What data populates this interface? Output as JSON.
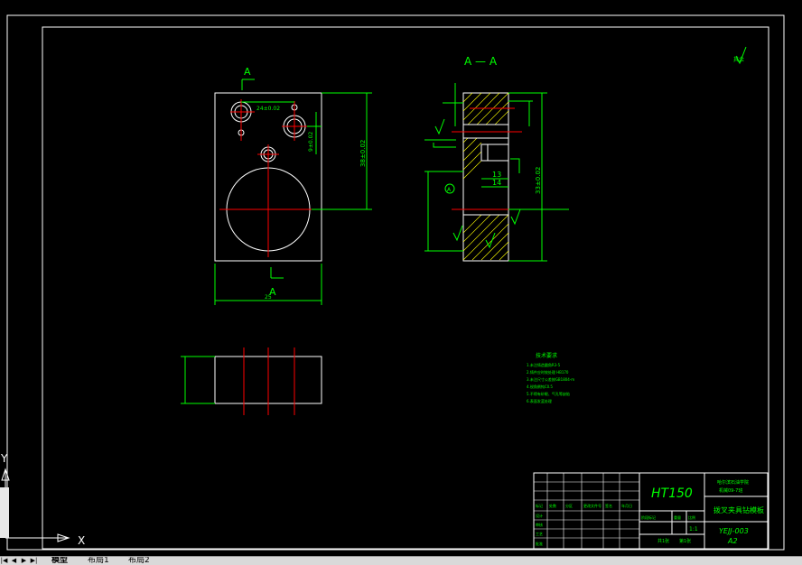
{
  "drawing": {
    "section_label": "A — A",
    "view_marker_top": "A",
    "view_marker_bottom": "A",
    "datum_label": "A",
    "dim_hole_spacing": "24±0.02",
    "dim_vertical_small": "9±0.02",
    "dim_height_front": "38±0.02",
    "dim_width_front": "25",
    "dim_section_height": "33±0.02",
    "dim_13": "13",
    "dim_14": "14",
    "roughness_top_right": "其余",
    "tech_title": "技术要求",
    "tech_lines": [
      "1.未注铸造圆角R3-5",
      "2.铸件应时效处理 HB170",
      "3.未注尺寸公差按GB1804-m",
      "4.锐角倒钝C0.5",
      "5.不得有砂眼、气孔等缺陷",
      "6.表面发蓝处理"
    ]
  },
  "title_block": {
    "material": "HT150",
    "school_line1": "哈尔滨石油学院",
    "school_line2": "机械09-7班",
    "part_name": "拨叉夹具钻模板",
    "drawing_no": "YEJJ-003",
    "sheet_size": "A2",
    "scale_label": "比例",
    "scale_value": "1:1",
    "sheet_info_left": "共1张",
    "sheet_info_right": "第1张",
    "row_labels": [
      "标记",
      "处数",
      "分区",
      "更改文件号",
      "签名",
      "年月日"
    ],
    "left_labels": [
      "设计",
      "审核",
      "工艺",
      "批准"
    ],
    "stage_label": "阶段标记",
    "weight_label": "重量"
  },
  "ucs": {
    "y_label": "Y",
    "x_label": "X"
  },
  "tabs": {
    "nav_first": "|◀",
    "nav_prev": "◀",
    "nav_next": "▶",
    "nav_last": "▶|",
    "items": [
      "模型",
      "布局1",
      "布局2"
    ]
  },
  "colors": {
    "background": "#000000",
    "geometry": "#ffffff",
    "dimensions": "#00ff00",
    "centerlines": "#ff0000",
    "hatch": "#ffff00",
    "cyan": "#00ffff"
  }
}
